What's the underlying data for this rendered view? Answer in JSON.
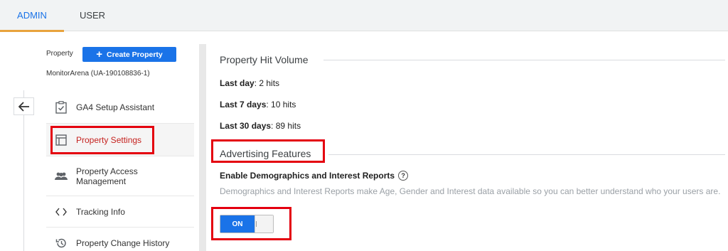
{
  "tabs": [
    {
      "label": "ADMIN",
      "active": true
    },
    {
      "label": "USER",
      "active": false
    }
  ],
  "property": {
    "label": "Property",
    "create_button": "Create Property",
    "account_name": "MonitorArena (UA-190108836-1)"
  },
  "nav": {
    "items": [
      {
        "label": "GA4 Setup Assistant",
        "icon": "clipboard-check-icon"
      },
      {
        "label": "Property Settings",
        "icon": "layout-icon",
        "active": true
      },
      {
        "label": "Property Access Management",
        "line1": "Property Access",
        "line2": "Management",
        "icon": "people-icon"
      },
      {
        "label": "Tracking Info",
        "icon": "code-brackets-icon"
      },
      {
        "label": "Property Change History",
        "icon": "history-icon"
      }
    ]
  },
  "hit_volume": {
    "title": "Property Hit Volume",
    "rows": [
      {
        "label": "Last day",
        "value": ": 2 hits"
      },
      {
        "label": "Last 7 days",
        "value": ": 10 hits"
      },
      {
        "label": "Last 30 days",
        "value": ": 89 hits"
      }
    ]
  },
  "advertising": {
    "title": "Advertising Features",
    "enable_label": "Enable Demographics and Interest Reports",
    "help_glyph": "?",
    "description": "Demographics and Interest Reports make Age, Gender and Interest data available so you can better understand who your users are.",
    "toggle_label": "ON"
  },
  "colors": {
    "accent": "#1a73e8",
    "highlight_box": "#e4000f",
    "active_text": "#c5221f"
  }
}
